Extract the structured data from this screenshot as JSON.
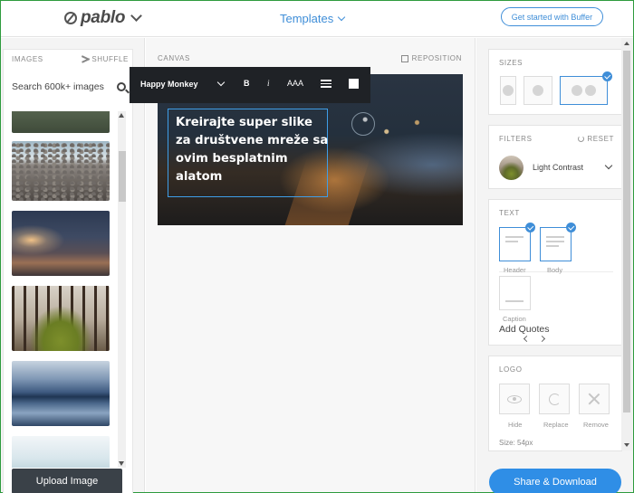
{
  "header": {
    "logo_text": "pablo",
    "templates_label": "Templates",
    "get_started_label": "Get started with Buffer"
  },
  "left": {
    "images_label": "IMAGES",
    "shuffle_label": "SHUFFLE",
    "search_placeholder": "Search 600k+ images",
    "upload_label": "Upload Image"
  },
  "canvas": {
    "label": "CANVAS",
    "reposition_label": "REPOSITION",
    "text": "Kreirajte super slike za društvene mreže sa ovim besplatnim alatom"
  },
  "toolbar": {
    "font_name": "Happy Monkey",
    "bold": "B",
    "italic": "i",
    "size": "AAA"
  },
  "right": {
    "sizes_label": "SIZES",
    "filters_label": "FILTERS",
    "reset_label": "RESET",
    "filter_name": "Light Contrast",
    "text_label": "TEXT",
    "text_options": [
      "Header",
      "Body",
      "Caption"
    ],
    "add_quotes": "Add Quotes",
    "logo_label": "LOGO",
    "logo_options": [
      "Hide",
      "Replace",
      "Remove"
    ],
    "logo_size": "Size: 54px"
  },
  "share_label": "Share & Download",
  "colors": {
    "accent": "#3f8ed8",
    "share_button": "#2f8ee6",
    "upload_button": "#3a4148",
    "toolbar_bg": "#1f2226"
  }
}
